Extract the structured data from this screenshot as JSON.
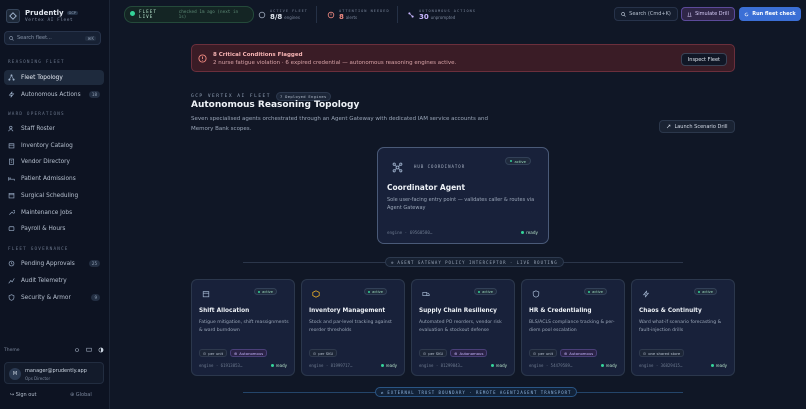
{
  "brand": {
    "name": "Prudently",
    "badge": "GCP",
    "sub": "Vertex AI Fleet"
  },
  "sidebar": {
    "search_placeholder": "Search fleet...",
    "search_kbd": "⌘K",
    "sections": [
      {
        "label": "REASONING FLEET",
        "items": [
          {
            "label": "Fleet Topology",
            "active": true,
            "icon": "topology-icon"
          },
          {
            "label": "Autonomous Actions",
            "count": "18",
            "icon": "bolt-icon"
          }
        ]
      },
      {
        "label": "WARD OPERATIONS",
        "items": [
          {
            "label": "Staff Roster",
            "icon": "users-icon"
          },
          {
            "label": "Inventory Catalog",
            "icon": "box-icon"
          },
          {
            "label": "Vendor Directory",
            "icon": "building-icon"
          },
          {
            "label": "Patient Admissions",
            "icon": "bed-icon"
          },
          {
            "label": "Surgical Scheduling",
            "icon": "calendar-icon"
          },
          {
            "label": "Maintenance Jobs",
            "icon": "wrench-icon"
          },
          {
            "label": "Payroll & Hours",
            "icon": "wallet-icon"
          }
        ]
      },
      {
        "label": "FLEET GOVERNANCE",
        "items": [
          {
            "label": "Pending Approvals",
            "count": "25",
            "icon": "clock-icon"
          },
          {
            "label": "Audit Telemetry",
            "icon": "chart-icon"
          },
          {
            "label": "Security & Armor",
            "count": "9",
            "icon": "shield-icon"
          }
        ]
      }
    ],
    "theme_label": "Theme",
    "user": {
      "initial": "M",
      "email": "manager@prudently.app",
      "role": "Ops Director"
    },
    "signout": "Sign out",
    "global": "Global"
  },
  "topbar": {
    "fleet_live": "FLEET LIVE",
    "fleet_live_sub": "checked 1m ago (next in 1s)",
    "active_fleet_label": "ACTIVE FLEET",
    "active_fleet_value": "8/8",
    "active_fleet_sub": "engines",
    "attention_label": "ATTENTION NEEDED",
    "attention_value": "8",
    "attention_sub": "alerts",
    "auto_label": "AUTONOMOUS ACTIONS",
    "auto_value": "30",
    "auto_sub": "unprompted",
    "search": "Search (Cmd+K)",
    "simulate": "Simulate Drill",
    "run": "Run fleet check"
  },
  "alert": {
    "title": "8 Critical Conditions Flagged",
    "body": "2 nurse fatigue violation · 6 expired credential — autonomous reasoning engines active.",
    "action": "Inspect Fleet"
  },
  "header": {
    "eyebrow": "GCP VERTEX AI FLEET",
    "pill": "7 Deployed Engines",
    "title": "Autonomous Reasoning Topology",
    "desc": "Seven specialised agents orchestrated through an Agent Gateway with dedicated IAM service accounts and Memory Bank scopes.",
    "launch": "Launch Scenario Drill"
  },
  "coordinator": {
    "tag": "HUB COORDINATOR",
    "status": "active",
    "title": "Coordinator Agent",
    "desc": "Sole user-facing entry point — validates caller & routes via Agent Gateway",
    "engine": "engine · 69560580…",
    "ready": "ready"
  },
  "policy": "AGENT GATEWAY POLICY INTERCEPTOR · LIVE ROUTING",
  "agents": [
    {
      "title": "Shift Allocation",
      "desc": "Fatigue mitigation, shift reassignments & ward burndown",
      "tag1": "per unit",
      "tag2": "Autonomous",
      "engine": "engine · 61913853…",
      "status": "active",
      "ready": "ready",
      "icon": "calendar-icon"
    },
    {
      "title": "Inventory Management",
      "desc": "Stock and par-level tracking against reorder thresholds",
      "tag1": "per SKU",
      "tag2": "",
      "engine": "engine · 81999717…",
      "status": "active",
      "ready": "ready",
      "icon": "box-icon"
    },
    {
      "title": "Supply Chain Resiliency",
      "desc": "Automated PO reorders, vendor risk evaluation & stockout defense",
      "tag1": "per SKU",
      "tag2": "Autonomous",
      "engine": "engine · 81299843…",
      "status": "active",
      "ready": "ready",
      "icon": "truck-icon"
    },
    {
      "title": "HR & Credentialing",
      "desc": "BLS/ACLS compliance tracking & per-diem pool escalation",
      "tag1": "per unit",
      "tag2": "Autonomous",
      "engine": "engine · 54479589…",
      "status": "active",
      "ready": "ready",
      "icon": "shield-icon"
    },
    {
      "title": "Chaos & Continuity",
      "desc": "Ward what-if scenario forecasting & fault-injection drills",
      "tag1": "one shared store",
      "tag2": "",
      "engine": "engine · 36829415…",
      "status": "active",
      "ready": "ready",
      "icon": "bolt-icon"
    }
  ],
  "boundary": "EXTERNAL TRUST BOUNDARY · REMOTE AGENT2AGENT TRANSPORT",
  "colors": {
    "accent": "#3b6fd6",
    "alert_bg": "#3a1c26",
    "ok": "#34d399",
    "autonomous": "#c8b6ff"
  }
}
